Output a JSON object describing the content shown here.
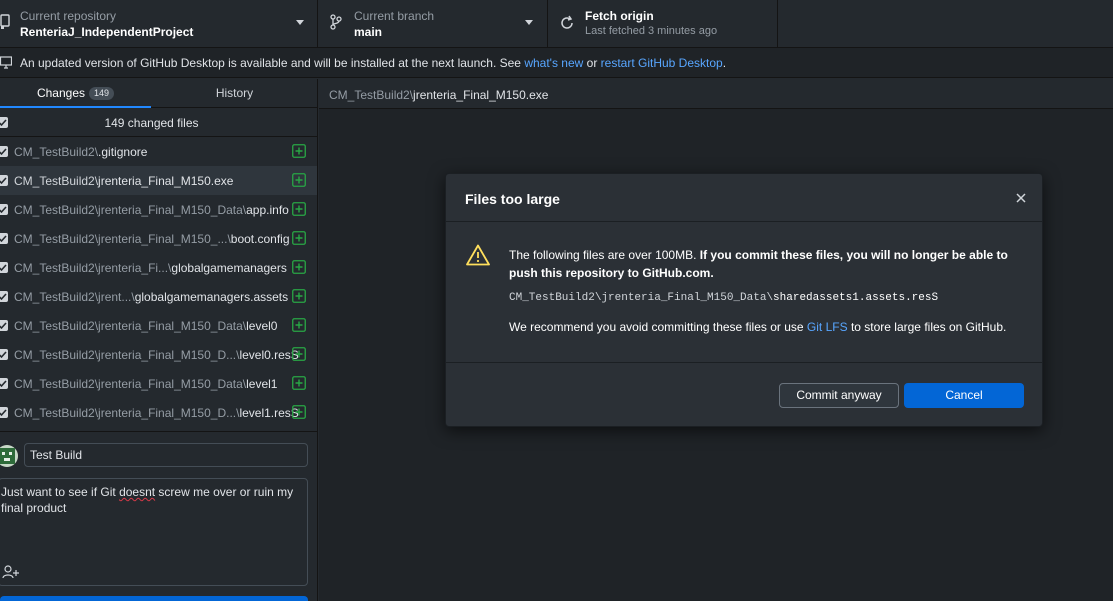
{
  "toolbar": {
    "repo_title": "Current repository",
    "repo_name": "RenteriaJ_IndependentProject",
    "branch_title": "Current branch",
    "branch_name": "main",
    "fetch_title": "Fetch origin",
    "fetch_sub": "Last fetched 3 minutes ago"
  },
  "banner": {
    "text": "An updated version of GitHub Desktop is available and will be installed at the next launch. See ",
    "link1": "what's new",
    "mid": " or ",
    "link2": "restart GitHub Desktop",
    "end": "."
  },
  "sidebar": {
    "tab_changes": "Changes",
    "tab_changes_count": "149",
    "tab_history": "History",
    "changed_files_label": "149 changed files",
    "files": [
      {
        "dir": "CM_TestBuild2\\",
        "name": ".gitignore"
      },
      {
        "dir": "CM_TestBuild2\\",
        "name": "jrenteria_Final_M150.exe"
      },
      {
        "dir": "CM_TestBuild2\\jrenteria_Final_M150_Data\\",
        "name": "app.info"
      },
      {
        "dir": "CM_TestBuild2\\jrenteria_Final_M150_...\\",
        "name": "boot.config"
      },
      {
        "dir": "CM_TestBuild2\\jrenteria_Fi...\\",
        "name": "globalgamemanagers"
      },
      {
        "dir": "CM_TestBuild2\\jrent...\\",
        "name": "globalgamemanagers.assets"
      },
      {
        "dir": "CM_TestBuild2\\jrenteria_Final_M150_Data\\",
        "name": "level0"
      },
      {
        "dir": "CM_TestBuild2\\jrenteria_Final_M150_D...\\",
        "name": "level0.resS"
      },
      {
        "dir": "CM_TestBuild2\\jrenteria_Final_M150_Data\\",
        "name": "level1"
      },
      {
        "dir": "CM_TestBuild2\\jrenteria_Final_M150_D...\\",
        "name": "level1.resS"
      }
    ],
    "summary_value": "Test Build",
    "description_pre": "Just want to see if Git ",
    "description_misspelled": "doesnt",
    "description_post": " screw me over or ruin my final product"
  },
  "main": {
    "header_dir": "CM_TestBuild2\\",
    "header_name": "jrenteria_Final_M150.exe"
  },
  "dialog": {
    "title": "Files too large",
    "msg_plain": "The following files are over 100MB. ",
    "msg_bold": "If you commit these files, you will no longer be able to push this repository to GitHub.com.",
    "file_dir": "CM_TestBuild2\\jrenteria_Final_M150_Data\\",
    "file_name": "sharedassets1.assets.resS",
    "recommend_pre": "We recommend you avoid committing these files or use ",
    "recommend_link": "Git LFS",
    "recommend_post": " to store large files on GitHub.",
    "commit_anyway": "Commit anyway",
    "cancel": "Cancel"
  },
  "colors": {
    "accent": "#0366d6",
    "link": "#58a6ff",
    "added": "#28a745",
    "warning": "#ffdf5d"
  },
  "icons": [
    "repo-icon",
    "branch-icon",
    "sync-icon",
    "desktop-download-icon",
    "checkbox-icon",
    "diff-added-icon",
    "alert-icon",
    "close-icon",
    "person-add-icon"
  ]
}
